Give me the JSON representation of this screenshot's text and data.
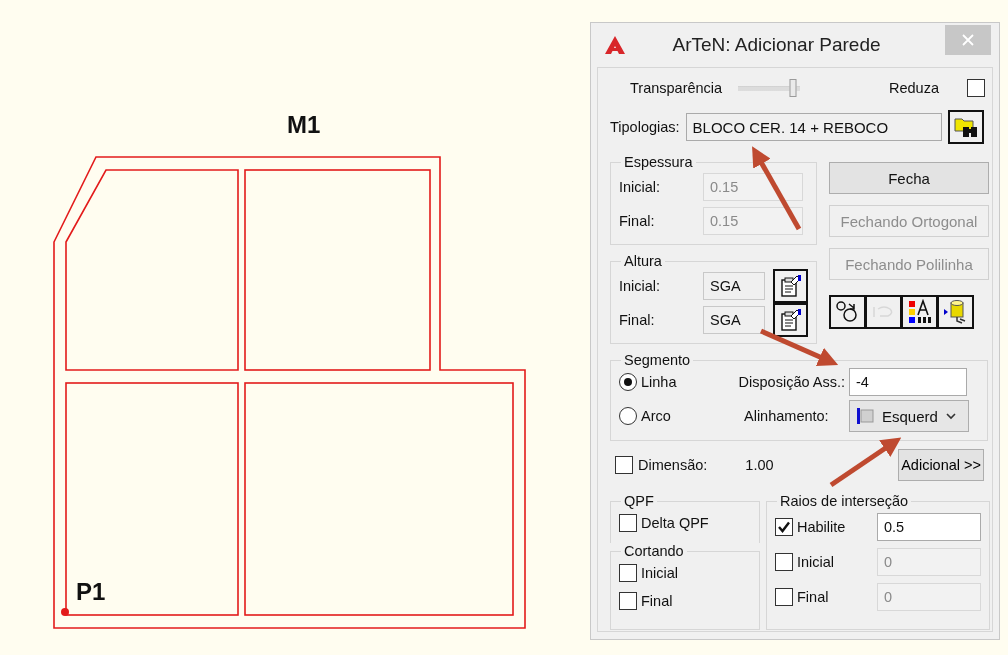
{
  "canvas": {
    "labels": [
      {
        "text": "M1"
      },
      {
        "text": "P1"
      }
    ]
  },
  "window": {
    "title": "ArTeN: Adicionar Parede"
  },
  "transparency": {
    "label": "Transparência",
    "level": 0.88
  },
  "reduce": {
    "label": "Reduza",
    "checked": false
  },
  "typology": {
    "label": "Tipologias:",
    "value": "BLOCO CER. 14 + REBOCO"
  },
  "thickness": {
    "title": "Espessura",
    "fields": [
      {
        "label": "Inicial:",
        "value": "0.15",
        "disabled": true
      },
      {
        "label": "Final:",
        "value": "0.15",
        "disabled": true
      }
    ]
  },
  "height": {
    "title": "Altura",
    "fields": [
      {
        "label": "Inicial:",
        "value": "SGA"
      },
      {
        "label": "Final:",
        "value": "SGA"
      }
    ]
  },
  "buttons": [
    {
      "label": "Fecha",
      "disabled": false
    },
    {
      "label": "Fechando Ortogonal",
      "disabled": true
    },
    {
      "label": "Fechando Polilinha",
      "disabled": true
    }
  ],
  "tool_buttons": [
    {
      "disabled": false
    },
    {
      "disabled": true
    },
    {
      "disabled": false
    },
    {
      "disabled": false
    }
  ],
  "segment": {
    "title": "Segmento",
    "options": [
      {
        "label": "Linha",
        "selected": true
      },
      {
        "label": "Arco",
        "selected": false
      }
    ],
    "offset": {
      "label": "Disposição Ass.:",
      "value": "-4"
    },
    "alignment": {
      "label": "Alinhamento:",
      "value": "Esquerd"
    }
  },
  "dimension": {
    "label": "Dimensão:",
    "checked": false,
    "value": "1.00"
  },
  "more_button": {
    "label": "Adicional >>"
  },
  "qpf": {
    "title": "QPF",
    "checks": [
      {
        "label": "Delta QPF",
        "checked": false
      }
    ]
  },
  "cutting": {
    "title": "Cortando",
    "checks": [
      {
        "label": "Inicial",
        "checked": false
      },
      {
        "label": "Final",
        "checked": false
      }
    ]
  },
  "intersection": {
    "title": "Raios de interseção",
    "rows": [
      {
        "label": "Habilite",
        "checked": true,
        "value": "0.5",
        "disabled": false
      },
      {
        "label": "Inicial",
        "checked": false,
        "value": "0",
        "disabled": true
      },
      {
        "label": "Final",
        "checked": false,
        "value": "0",
        "disabled": true
      }
    ]
  }
}
